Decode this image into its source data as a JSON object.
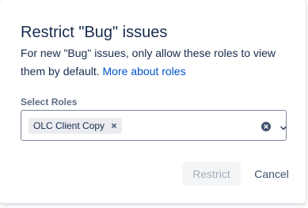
{
  "dialog": {
    "title": "Restrict \"Bug\" issues",
    "description": "For new \"Bug\" issues, only allow these roles to view them by default.",
    "link_label": "More about roles"
  },
  "roles_field": {
    "label": "Select Roles",
    "selected": [
      {
        "label": "OLC Client Copy"
      }
    ]
  },
  "footer": {
    "restrict_label": "Restrict",
    "cancel_label": "Cancel"
  },
  "colors": {
    "text": "#172B4D",
    "link": "#0052CC",
    "label": "#5E6C84",
    "disabled_bg": "#F4F5F7",
    "disabled_text": "#A5ADBA",
    "chip_bg": "#EBECF0"
  }
}
